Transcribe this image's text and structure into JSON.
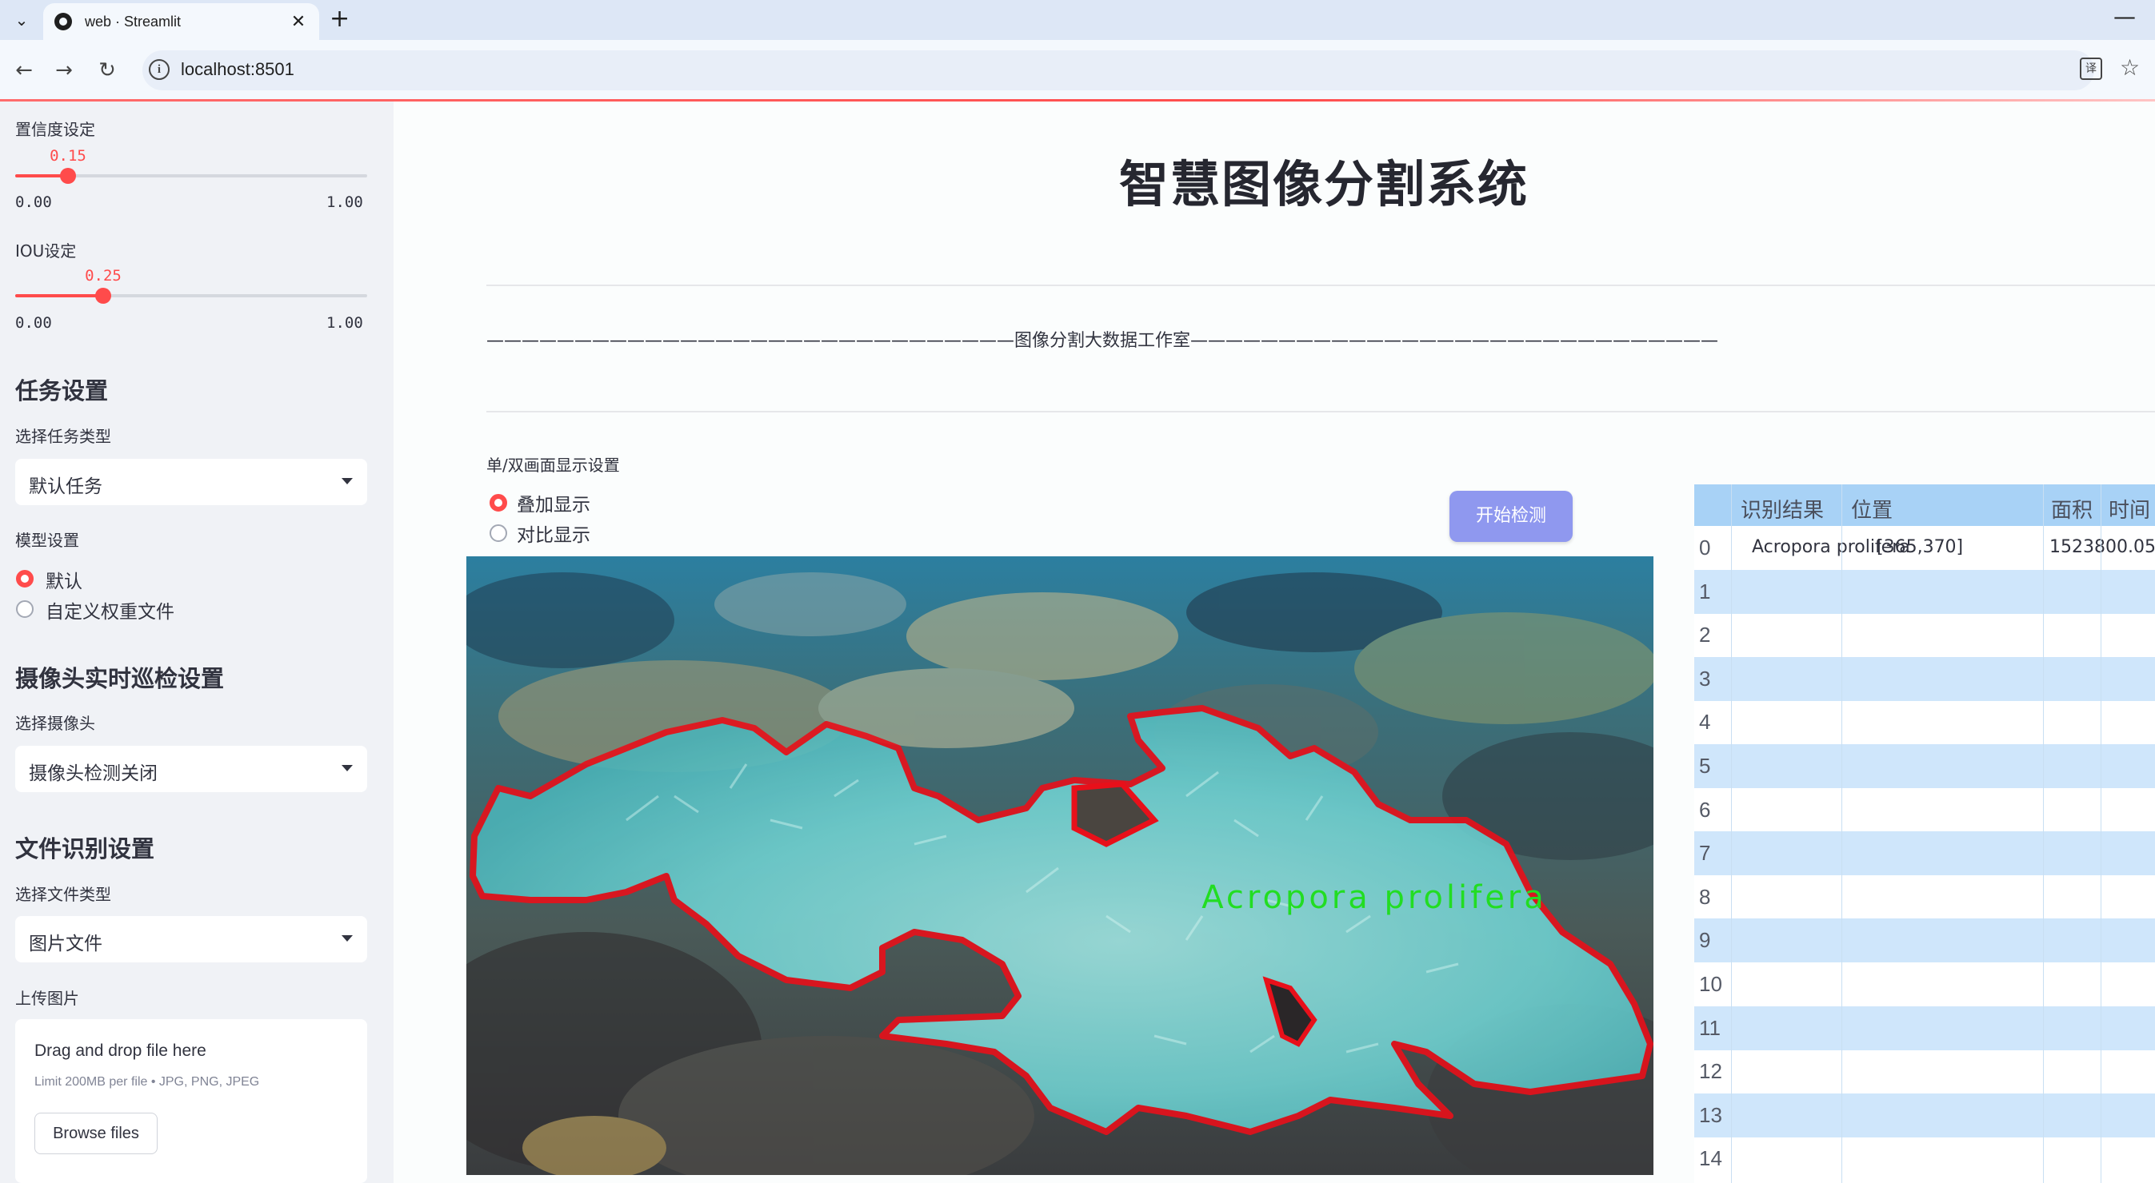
{
  "browser": {
    "tab_title": "web · Streamlit",
    "url": "localhost:8501",
    "icons": [
      "chevron-down-icon",
      "streamlit-favicon",
      "close-icon",
      "plus-icon",
      "minimize-icon",
      "back-arrow-icon",
      "forward-arrow-icon",
      "reload-icon",
      "info-icon",
      "translate-icon",
      "star-icon"
    ]
  },
  "sidebar": {
    "confidence": {
      "label": "置信度设定",
      "value": "0.15",
      "min": "0.00",
      "max": "1.00",
      "fraction": 0.15
    },
    "iou": {
      "label": "IOU设定",
      "value": "0.25",
      "min": "0.00",
      "max": "1.00",
      "fraction": 0.25
    },
    "task": {
      "heading": "任务设置",
      "label": "选择任务类型",
      "selected": "默认任务"
    },
    "model": {
      "label": "模型设置",
      "options": [
        "默认",
        "自定义权重文件"
      ],
      "selected_index": 0
    },
    "camera": {
      "heading": "摄像头实时巡检设置",
      "label": "选择摄像头",
      "selected": "摄像头检测关闭"
    },
    "file": {
      "heading": "文件识别设置",
      "label": "选择文件类型",
      "selected": "图片文件"
    },
    "upload": {
      "label": "上传图片",
      "title": "Drag and drop file here",
      "subtitle": "Limit 200MB per file • JPG, PNG, JPEG",
      "button": "Browse files"
    }
  },
  "main": {
    "title": "智慧图像分割系统",
    "banner": "——————————————————————————————图像分割大数据工作室——————————————————————————————",
    "display_mode": {
      "label": "单/双画面显示设置",
      "options": [
        "叠加显示",
        "对比显示"
      ],
      "selected_index": 0
    },
    "start_button": "开始检测",
    "detection_label": "Acropora prolifera",
    "colors": {
      "accent": "#ff4b4b",
      "button": "#8f98ef",
      "table_header": "#a8d2f6",
      "table_row_alt": "#cfe6fb",
      "mask_outline": "#e8101a",
      "mask_label": "#22dd22"
    }
  },
  "table": {
    "columns": [
      "识别结果",
      "位置",
      "面积",
      "时间"
    ],
    "rows": [
      {
        "index": "0",
        "result": "Acropora prolifera",
        "position": "[365,370]",
        "area": "1523800.05",
        "time": ""
      },
      {
        "index": "1",
        "result": "",
        "position": "",
        "area": "",
        "time": ""
      },
      {
        "index": "2",
        "result": "",
        "position": "",
        "area": "",
        "time": ""
      },
      {
        "index": "3",
        "result": "",
        "position": "",
        "area": "",
        "time": ""
      },
      {
        "index": "4",
        "result": "",
        "position": "",
        "area": "",
        "time": ""
      },
      {
        "index": "5",
        "result": "",
        "position": "",
        "area": "",
        "time": ""
      },
      {
        "index": "6",
        "result": "",
        "position": "",
        "area": "",
        "time": ""
      },
      {
        "index": "7",
        "result": "",
        "position": "",
        "area": "",
        "time": ""
      },
      {
        "index": "8",
        "result": "",
        "position": "",
        "area": "",
        "time": ""
      },
      {
        "index": "9",
        "result": "",
        "position": "",
        "area": "",
        "time": ""
      },
      {
        "index": "10",
        "result": "",
        "position": "",
        "area": "",
        "time": ""
      },
      {
        "index": "11",
        "result": "",
        "position": "",
        "area": "",
        "time": ""
      },
      {
        "index": "12",
        "result": "",
        "position": "",
        "area": "",
        "time": ""
      },
      {
        "index": "13",
        "result": "",
        "position": "",
        "area": "",
        "time": ""
      },
      {
        "index": "14",
        "result": "",
        "position": "",
        "area": "",
        "time": ""
      }
    ]
  }
}
